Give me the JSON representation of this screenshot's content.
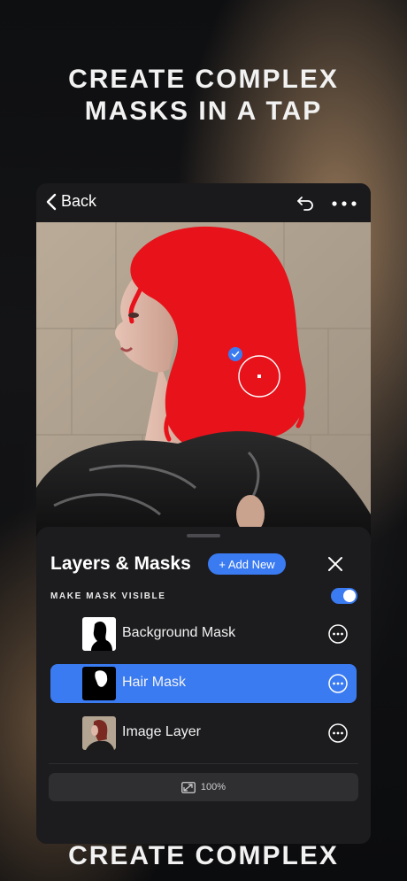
{
  "headline": {
    "line1": "CREATE COMPLEX",
    "line2": "MASKS IN A TAP"
  },
  "footer": {
    "text": "CREATE COMPLEX"
  },
  "topbar": {
    "back_label": "Back",
    "back_icon": "chevron-left-icon",
    "undo_icon": "undo-icon",
    "more_icon": "more-horizontal-icon"
  },
  "panel": {
    "title": "Layers & Masks",
    "add_new_label": "+ Add New",
    "close_icon": "close-icon",
    "make_mask_visible_label": "MAKE MASK VISIBLE",
    "make_mask_visible_on": true,
    "layers": [
      {
        "label": "Background Mask",
        "selected": false,
        "thumb": "background-mask"
      },
      {
        "label": "Hair Mask",
        "selected": true,
        "thumb": "hair-mask"
      },
      {
        "label": "Image Layer",
        "selected": false,
        "thumb": "image"
      }
    ],
    "zoom_label": "100%",
    "zoom_icon": "image-scale-icon"
  },
  "colors": {
    "accent": "#3a7bf2",
    "panel_bg": "#1c1c1e",
    "hair_mask": "#e8121b"
  }
}
